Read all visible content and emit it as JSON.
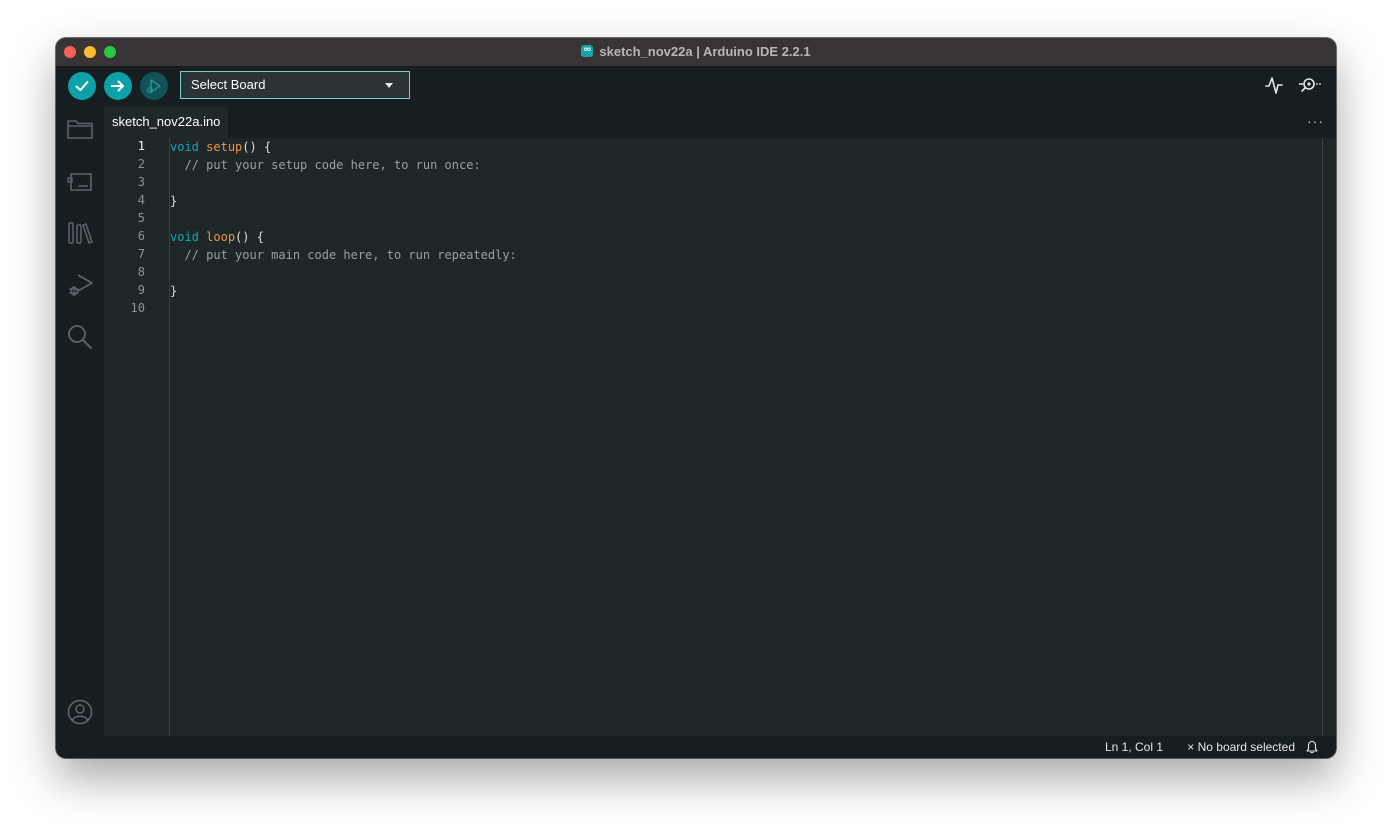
{
  "window": {
    "title": "sketch_nov22a | Arduino IDE 2.2.1",
    "app_icon": "arduino-logo-icon"
  },
  "toolbar": {
    "verify_icon": "checkmark-icon",
    "upload_icon": "arrow-right-icon",
    "debug_icon": "debug-play-icon",
    "board_select_label": "Select Board",
    "serial_plotter_icon": "serial-plotter-icon",
    "serial_monitor_icon": "serial-monitor-icon"
  },
  "sidebar": {
    "items": [
      {
        "id": "sketchbook",
        "icon": "folder-icon"
      },
      {
        "id": "boards-manager",
        "icon": "board-icon"
      },
      {
        "id": "library-manager",
        "icon": "library-icon"
      },
      {
        "id": "debug",
        "icon": "debug-icon"
      },
      {
        "id": "search",
        "icon": "search-icon"
      }
    ],
    "bottom": {
      "id": "profile",
      "icon": "user-profile-icon"
    }
  },
  "tabs": [
    {
      "label": "sketch_nov22a.ino",
      "active": true
    }
  ],
  "tab_more_label": "···",
  "editor": {
    "line_numbers": [
      "1",
      "2",
      "3",
      "4",
      "5",
      "6",
      "7",
      "8",
      "9",
      "10"
    ],
    "active_line": 1,
    "lines": [
      {
        "tokens": [
          {
            "t": "void",
            "c": "kw"
          },
          {
            "t": " ",
            "c": ""
          },
          {
            "t": "setup",
            "c": "fn"
          },
          {
            "t": "() {",
            "c": ""
          }
        ]
      },
      {
        "tokens": [
          {
            "t": "  // put your setup code here, to run once:",
            "c": "cm"
          }
        ]
      },
      {
        "tokens": []
      },
      {
        "tokens": [
          {
            "t": "}",
            "c": ""
          }
        ]
      },
      {
        "tokens": []
      },
      {
        "tokens": [
          {
            "t": "void",
            "c": "kw"
          },
          {
            "t": " ",
            "c": ""
          },
          {
            "t": "loop",
            "c": "fn"
          },
          {
            "t": "() {",
            "c": ""
          }
        ]
      },
      {
        "tokens": [
          {
            "t": "  // put your main code here, to run repeatedly:",
            "c": "cm"
          }
        ]
      },
      {
        "tokens": []
      },
      {
        "tokens": [
          {
            "t": "}",
            "c": ""
          }
        ]
      },
      {
        "tokens": []
      }
    ]
  },
  "status": {
    "position": "Ln 1, Col 1",
    "board": "× No board selected",
    "bell_icon": "bell-icon"
  },
  "colors": {
    "accent": "#0ca1a6",
    "keyword": "#0fa5ad",
    "function": "#e9963a",
    "comment": "#95a0a4"
  }
}
